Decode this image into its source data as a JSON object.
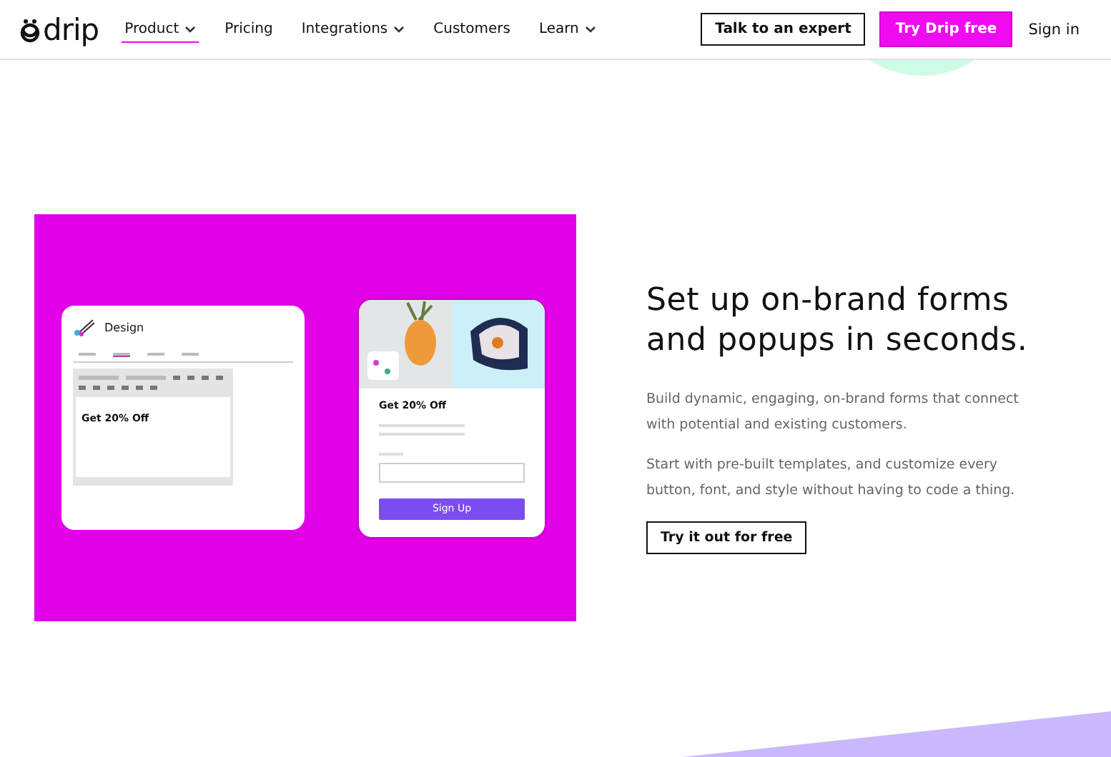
{
  "nav": {
    "logo": "drip",
    "items": [
      {
        "label": "Product",
        "dropdown": true,
        "selected": true
      },
      {
        "label": "Pricing",
        "dropdown": false,
        "selected": false
      },
      {
        "label": "Integrations",
        "dropdown": true,
        "selected": false
      },
      {
        "label": "Customers",
        "dropdown": false,
        "selected": false
      },
      {
        "label": "Learn",
        "dropdown": true,
        "selected": false
      }
    ],
    "expert_button": "Talk to an expert",
    "trial_button": "Try Drip free",
    "sign_in": "Sign in"
  },
  "hero": {
    "design_card": {
      "title": "Design",
      "editor_text": "Get 20% Off"
    },
    "popup_card": {
      "heading": "Get 20% Off",
      "button": "Sign Up"
    },
    "heading": "Set up on-brand forms and popups in seconds.",
    "paragraphs": [
      "Build dynamic, engaging, on-brand forms that connect with potential and existing customers.",
      "Start with pre-built templates, and customize every button, font, and style without having to code a thing."
    ],
    "cta": "Try it out for free"
  }
}
